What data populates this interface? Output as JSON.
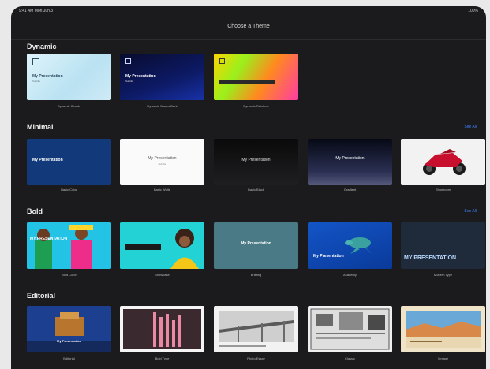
{
  "status": {
    "left": "9:41 AM  Mon Jun 3",
    "right": "100%"
  },
  "window": {
    "title": "Choose a Theme"
  },
  "sections": [
    {
      "title": "Dynamic",
      "see_all": "",
      "themes": [
        {
          "name": "Dynamic Clouds",
          "title_text": "My Presentation",
          "subtitle_text": "Subtitle"
        },
        {
          "name": "Dynamic Waves Dark",
          "title_text": "My Presentation",
          "subtitle_text": "Subtitle"
        },
        {
          "name": "Dynamic Rainbow",
          "title_text": "",
          "subtitle_text": ""
        }
      ]
    },
    {
      "title": "Minimal",
      "see_all": "See All",
      "themes": [
        {
          "name": "Basic Color",
          "title_text": "My Presentation",
          "subtitle_text": ""
        },
        {
          "name": "Basic White",
          "title_text": "My Presentation",
          "subtitle_text": "Subtitle"
        },
        {
          "name": "Basic Black",
          "title_text": "My Presentation",
          "subtitle_text": ""
        },
        {
          "name": "Gradient",
          "title_text": "My Presentation",
          "subtitle_text": ""
        },
        {
          "name": "Showroom",
          "title_text": "",
          "subtitle_text": ""
        }
      ]
    },
    {
      "title": "Bold",
      "see_all": "See All",
      "themes": [
        {
          "name": "Bold Color",
          "title_text": "MY PRESENTATION",
          "subtitle_text": ""
        },
        {
          "name": "Showcase",
          "title_text": "",
          "subtitle_text": ""
        },
        {
          "name": "Briefing",
          "title_text": "My Presentation",
          "subtitle_text": ""
        },
        {
          "name": "Academy",
          "title_text": "My Presentation",
          "subtitle_text": ""
        },
        {
          "name": "Modern Type",
          "title_text": "MY PRESENTATION",
          "subtitle_text": ""
        }
      ]
    },
    {
      "title": "Editorial",
      "see_all": "",
      "themes": [
        {
          "name": "Editorial",
          "title_text": "My Presentation",
          "subtitle_text": ""
        },
        {
          "name": "Bold Type",
          "title_text": "",
          "subtitle_text": ""
        },
        {
          "name": "Photo Essay",
          "title_text": "",
          "subtitle_text": ""
        },
        {
          "name": "Classic",
          "title_text": "",
          "subtitle_text": ""
        },
        {
          "name": "Vintage",
          "title_text": "",
          "subtitle_text": ""
        }
      ]
    }
  ],
  "colors": {
    "background": "#1b1b1d",
    "accent": "#3b82f6"
  }
}
